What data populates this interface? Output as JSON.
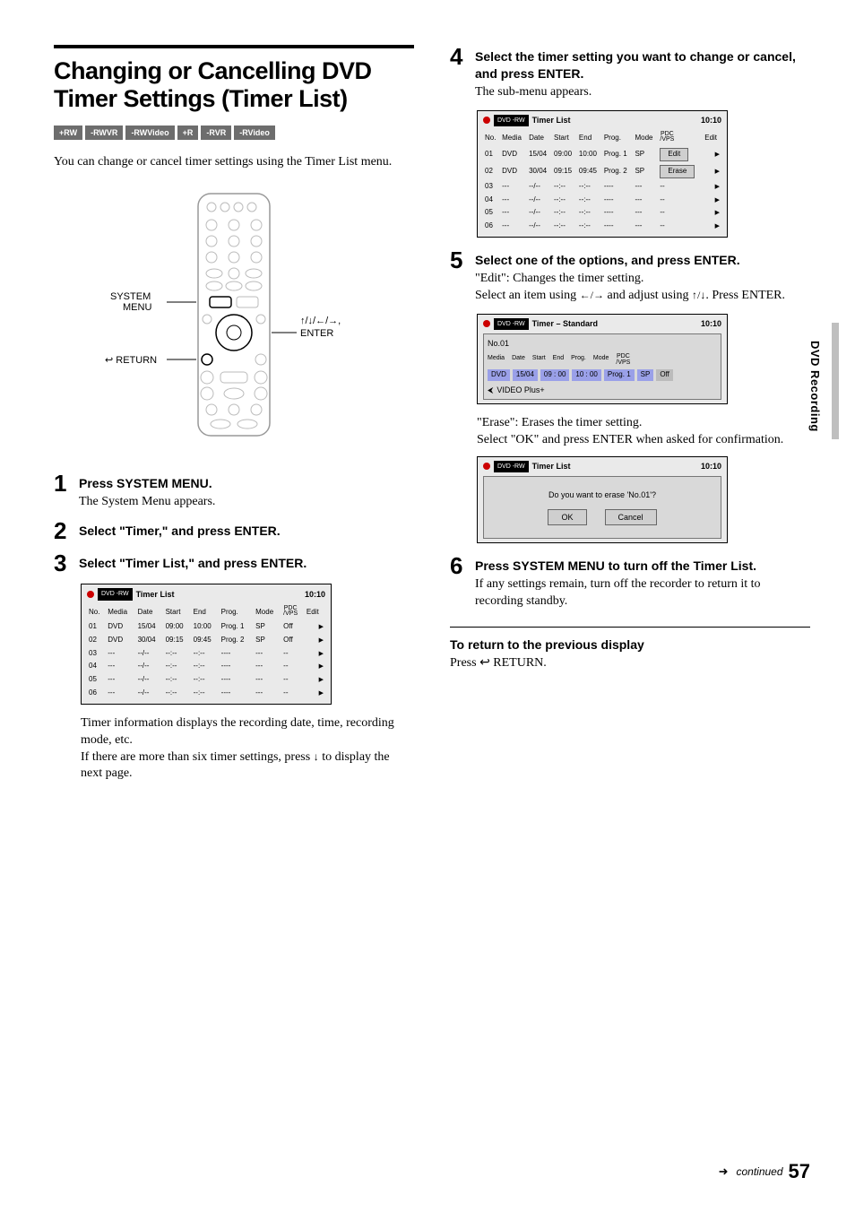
{
  "side_tab": "DVD Recording",
  "page_number": "57",
  "continued": "continued",
  "left": {
    "title": "Changing or Cancelling DVD Timer Settings (Timer List)",
    "badges": [
      "+RW",
      "-RWVR",
      "-RWVideo",
      "+R",
      "-RVR",
      "-RVideo"
    ],
    "intro": "You can change or cancel timer settings using the Timer List menu.",
    "remote_labels": {
      "system_menu": "SYSTEM MENU",
      "return": "RETURN",
      "arrows_enter": "↑/↓/←/→, ENTER"
    },
    "steps": {
      "s1": {
        "num": "1",
        "title": "Press SYSTEM MENU.",
        "text": "The System Menu appears."
      },
      "s2": {
        "num": "2",
        "title": "Select \"Timer,\" and press ENTER."
      },
      "s3": {
        "num": "3",
        "title": "Select \"Timer List,\" and press ENTER."
      }
    },
    "osd1": {
      "title": "Timer List",
      "clock": "10:10",
      "headers": [
        "No.",
        "Media",
        "Date",
        "Start",
        "End",
        "Prog.",
        "Mode",
        "PDC /VPS",
        "Edit"
      ],
      "rows": [
        [
          "01",
          "DVD",
          "15/04",
          "09:00",
          "10:00",
          "Prog. 1",
          "SP",
          "Off",
          ""
        ],
        [
          "02",
          "DVD",
          "30/04",
          "09:15",
          "09:45",
          "Prog. 2",
          "SP",
          "Off",
          ""
        ],
        [
          "03",
          "---",
          "--/--",
          "--:--",
          "--:--",
          "----",
          "---",
          "--",
          ""
        ],
        [
          "04",
          "---",
          "--/--",
          "--:--",
          "--:--",
          "----",
          "---",
          "--",
          ""
        ],
        [
          "05",
          "---",
          "--/--",
          "--:--",
          "--:--",
          "----",
          "---",
          "--",
          ""
        ],
        [
          "06",
          "---",
          "--/--",
          "--:--",
          "--:--",
          "----",
          "---",
          "--",
          ""
        ]
      ]
    },
    "after_osd": "Timer information displays the recording date, time, recording mode, etc.",
    "after_osd2_a": "If there are more than six timer settings, press ",
    "after_osd2_b": " to display the next page."
  },
  "right": {
    "s4": {
      "num": "4",
      "title": "Select the timer setting you want to change or cancel, and press ENTER.",
      "text": "The sub-menu appears."
    },
    "osd2": {
      "title": "Timer List",
      "clock": "10:10",
      "headers": [
        "No.",
        "Media",
        "Date",
        "Start",
        "End",
        "Prog.",
        "Mode",
        "PDC /VPS",
        "Edit"
      ],
      "menu": [
        "Edit",
        "Erase"
      ],
      "rows": [
        [
          "01",
          "DVD",
          "15/04",
          "09:00",
          "10:00",
          "Prog. 1",
          "SP",
          "",
          ""
        ],
        [
          "02",
          "DVD",
          "30/04",
          "09:15",
          "09:45",
          "Prog. 2",
          "SP",
          "",
          ""
        ],
        [
          "03",
          "---",
          "--/--",
          "--:--",
          "--:--",
          "----",
          "---",
          "--",
          ""
        ],
        [
          "04",
          "---",
          "--/--",
          "--:--",
          "--:--",
          "----",
          "---",
          "--",
          ""
        ],
        [
          "05",
          "---",
          "--/--",
          "--:--",
          "--:--",
          "----",
          "---",
          "--",
          ""
        ],
        [
          "06",
          "---",
          "--/--",
          "--:--",
          "--:--",
          "----",
          "---",
          "--",
          ""
        ]
      ]
    },
    "s5": {
      "num": "5",
      "title": "Select one of the options, and press ENTER.",
      "line1": "\"Edit\": Changes the timer setting.",
      "line2a": "Select an item using ",
      "line2b": " and adjust using ",
      "line2c": ". Press ENTER."
    },
    "osd3": {
      "title": "Timer – Standard",
      "clock": "10:10",
      "no_label": "No.01",
      "headers": [
        "Media",
        "Date",
        "Start",
        "End",
        "Prog.",
        "Mode",
        "PDC /VPS"
      ],
      "row": [
        "DVD",
        "15/04",
        "09 : 00",
        "10 : 00",
        "Prog. 1",
        "SP",
        "Off"
      ],
      "video_plus": "VIDEO Plus+"
    },
    "erase_line": "\"Erase\": Erases the timer setting.",
    "erase_line2": "Select \"OK\" and press ENTER when asked for confirmation.",
    "osd4": {
      "title": "Timer List",
      "clock": "10:10",
      "dialog_text": "Do you want to erase 'No.01'?",
      "ok": "OK",
      "cancel": "Cancel"
    },
    "s6": {
      "num": "6",
      "title": "Press SYSTEM MENU to turn off the Timer List.",
      "text": "If any settings remain, turn off the recorder to return it to recording standby."
    },
    "return_heading": "To return to the previous display",
    "return_text_a": "Press ",
    "return_text_b": " RETURN."
  }
}
